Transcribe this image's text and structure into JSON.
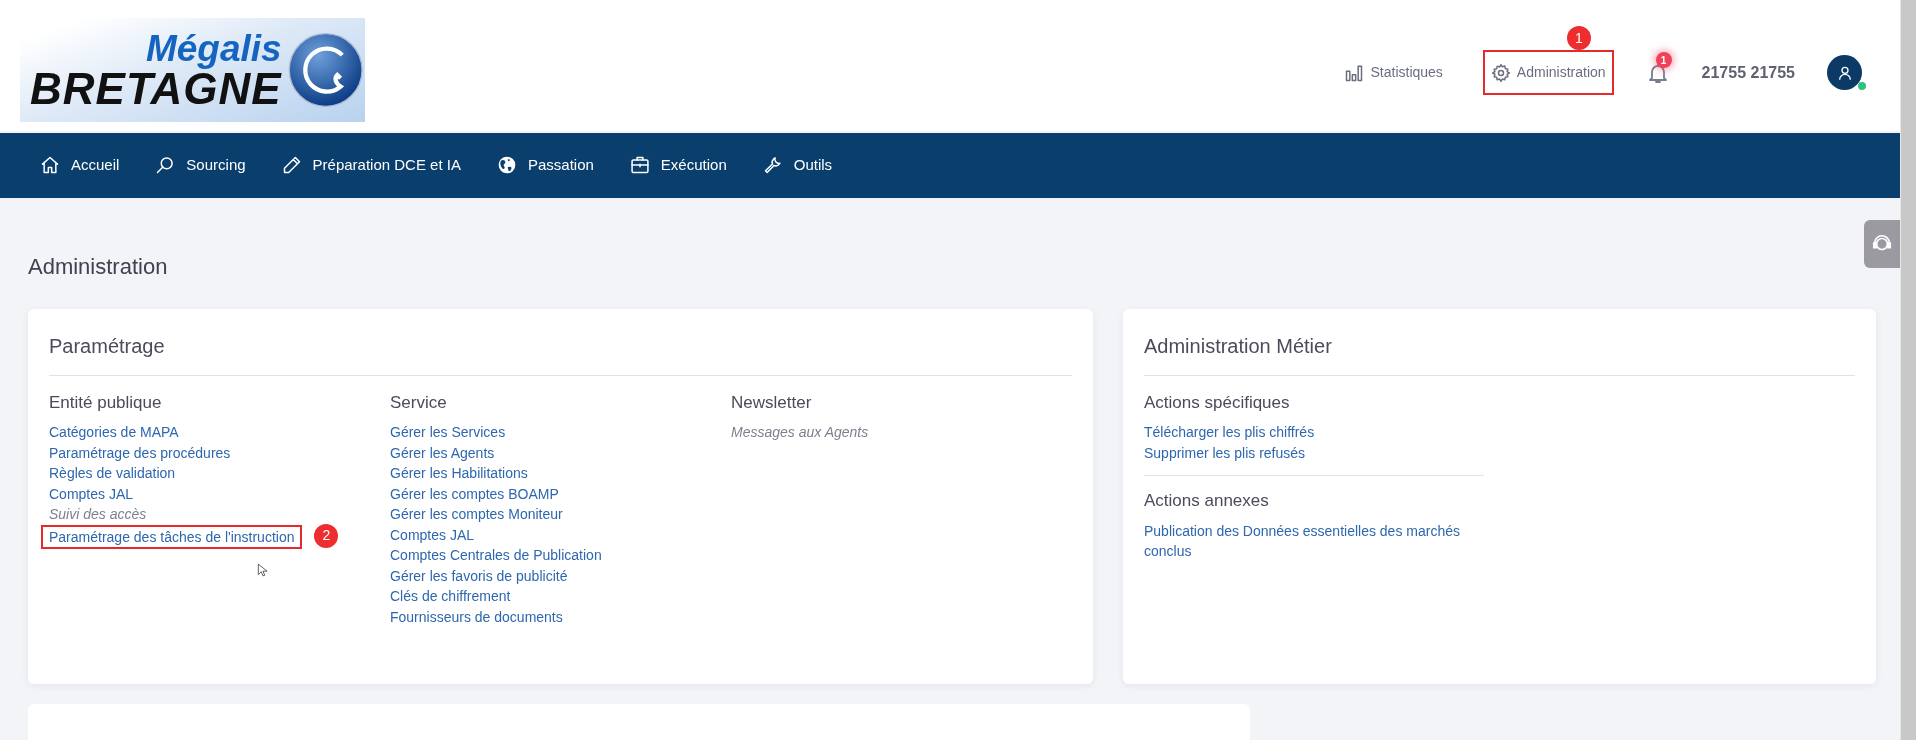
{
  "header": {
    "logo": {
      "line_1": "Mégalis",
      "line_2": "BRETAGNE"
    },
    "links": [
      {
        "kind": "stats",
        "label": "Statistiques",
        "highlighted": false
      },
      {
        "kind": "admin",
        "label": "Administration",
        "highlighted": true,
        "marker": "1"
      }
    ],
    "notifications": {
      "count": "1"
    },
    "user": {
      "name": "21755 21755",
      "online": true
    }
  },
  "nav": [
    {
      "kind": "home",
      "label": "Accueil"
    },
    {
      "kind": "search",
      "label": "Sourcing"
    },
    {
      "kind": "pencil",
      "label": "Préparation DCE et IA"
    },
    {
      "kind": "globe",
      "label": "Passation"
    },
    {
      "kind": "briefcase",
      "label": "Exécution"
    },
    {
      "kind": "wrench",
      "label": "Outils"
    }
  ],
  "page_title": "Administration",
  "cards": [
    {
      "title": "Paramétrage",
      "kind": "columns",
      "sections": [
        {
          "heading": "Entité publique",
          "items": [
            {
              "label": "Catégories de MAPA",
              "disabled": false,
              "highlighted": false
            },
            {
              "label": "Paramétrage des procédures",
              "disabled": false,
              "highlighted": false
            },
            {
              "label": "Règles de validation",
              "disabled": false,
              "highlighted": false
            },
            {
              "label": "Comptes JAL",
              "disabled": false,
              "highlighted": false
            },
            {
              "label": "Suivi des accès",
              "disabled": true,
              "highlighted": false
            },
            {
              "label": "Paramétrage des tâches de l'instruction",
              "disabled": false,
              "highlighted": true,
              "marker": "2"
            }
          ]
        },
        {
          "heading": "Service",
          "items": [
            {
              "label": "Gérer les Services",
              "disabled": false,
              "highlighted": false
            },
            {
              "label": "Gérer les Agents",
              "disabled": false,
              "highlighted": false
            },
            {
              "label": "Gérer les Habilitations",
              "disabled": false,
              "highlighted": false
            },
            {
              "label": "Gérer les comptes BOAMP",
              "disabled": false,
              "highlighted": false
            },
            {
              "label": "Gérer les comptes Moniteur",
              "disabled": false,
              "highlighted": false
            },
            {
              "label": "Comptes JAL",
              "disabled": false,
              "highlighted": false
            },
            {
              "label": "Comptes Centrales de Publication",
              "disabled": false,
              "highlighted": false
            },
            {
              "label": "Gérer les favoris de publicité",
              "disabled": false,
              "highlighted": false
            },
            {
              "label": "Clés de chiffrement",
              "disabled": false,
              "highlighted": false
            },
            {
              "label": "Fournisseurs de documents",
              "disabled": false,
              "highlighted": false
            }
          ]
        },
        {
          "heading": "Newsletter",
          "items": [
            {
              "label": "Messages aux Agents",
              "disabled": true,
              "highlighted": false
            }
          ]
        }
      ]
    },
    {
      "title": "Administration Métier",
      "kind": "stacked",
      "sections": [
        {
          "heading": "Actions spécifiques",
          "items": [
            {
              "label": "Télécharger les plis chiffrés",
              "disabled": false,
              "highlighted": false
            },
            {
              "label": "Supprimer les plis refusés",
              "disabled": false,
              "highlighted": false
            }
          ]
        },
        {
          "heading": "Actions annexes",
          "items": [
            {
              "label": "Publication des Données essentielles des marchés conclus",
              "disabled": false,
              "highlighted": false
            }
          ]
        }
      ]
    }
  ]
}
